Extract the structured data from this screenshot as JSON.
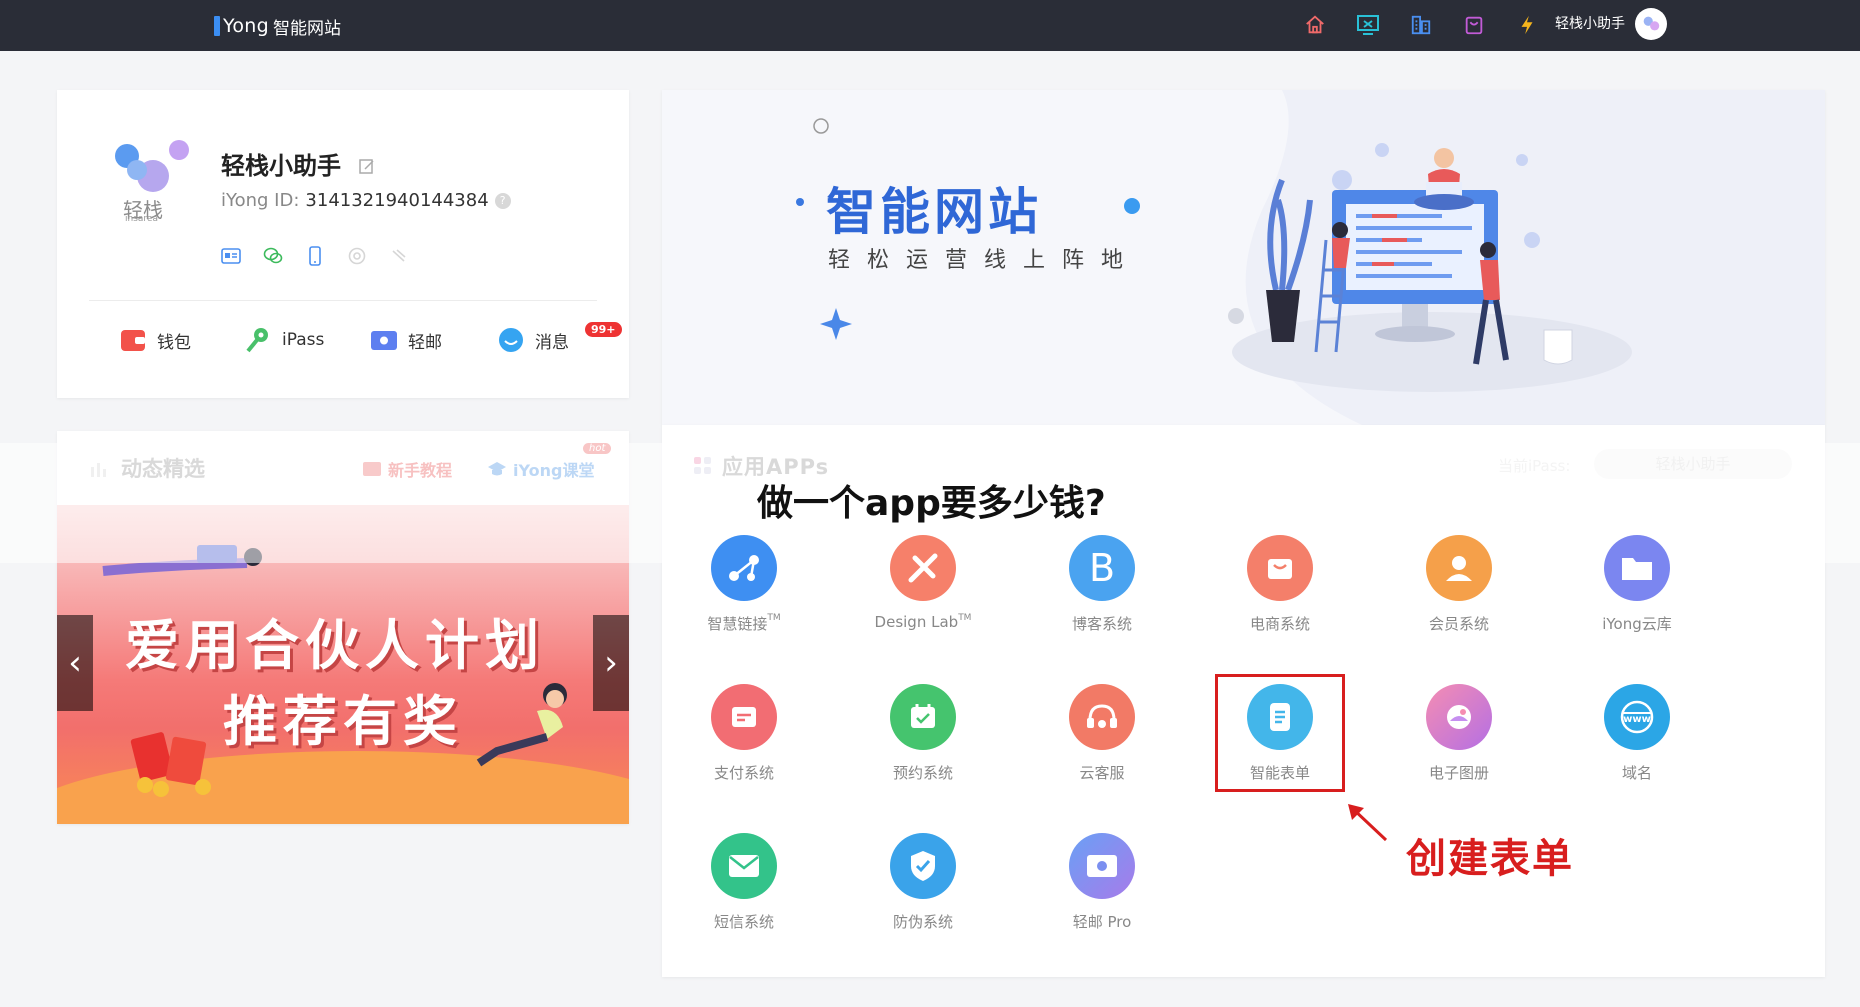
{
  "topbar": {
    "brand_letter": "i",
    "brand_name": "Yong",
    "brand_sub": "智能网站",
    "username": "轻栈小助手",
    "icons": [
      "home-icon",
      "monitor-icon",
      "building-icon",
      "bag-icon",
      "lightning-icon"
    ]
  },
  "profile": {
    "logo_text": "轻栈",
    "logo_sub": "insarea",
    "name": "轻栈小助手",
    "id_label": "iYong ID:",
    "id_value": "3141321940144384",
    "id_help": "?",
    "quick_links": [
      {
        "label": "钱包",
        "icon": "wallet-icon"
      },
      {
        "label": "iPass",
        "icon": "key-icon"
      },
      {
        "label": "轻邮",
        "icon": "mail-icon"
      },
      {
        "label": "消息",
        "icon": "message-icon"
      }
    ],
    "message_badge": "99+"
  },
  "news": {
    "title": "动态精选",
    "tab_tutorial": "新手教程",
    "tab_classroom": "iYong课堂",
    "hot": "hot",
    "banner_line1": "爱用合伙人计划",
    "banner_line2": "推荐有奖",
    "prev": "‹",
    "next": "›"
  },
  "hero": {
    "title": "智能网站",
    "subtitle": "轻松运营线上阵地"
  },
  "apps": {
    "title": "应用APPs",
    "ipass_label": "当前iPass:",
    "ipass_value": "轻栈小助手",
    "overlay_question": "做一个app要多少钱?",
    "callout": "创建表单",
    "items": [
      {
        "label": "智慧链接",
        "tm": "TM",
        "color": "#3e8ff2",
        "icon": "link-nodes-icon"
      },
      {
        "label": "Design Lab",
        "tm": "TM",
        "color": "#f6806a",
        "icon": "design-tools-icon"
      },
      {
        "label": "博客系统",
        "tm": "",
        "color": "#4aa3f0",
        "icon": "letter-b-icon"
      },
      {
        "label": "电商系统",
        "tm": "",
        "color": "#f47f6a",
        "icon": "shop-icon"
      },
      {
        "label": "会员系统",
        "tm": "",
        "color": "#f5a04a",
        "icon": "user-icon"
      },
      {
        "label": "iYong云库",
        "tm": "",
        "color": "#7b86f0",
        "icon": "folder-icon"
      },
      {
        "label": "支付系统",
        "tm": "",
        "color": "#f26d73",
        "icon": "payment-card-icon"
      },
      {
        "label": "预约系统",
        "tm": "",
        "color": "#45c46e",
        "icon": "calendar-icon"
      },
      {
        "label": "云客服",
        "tm": "",
        "color": "#f27a66",
        "icon": "headset-icon"
      },
      {
        "label": "智能表单",
        "tm": "",
        "color": "#43b6ea",
        "icon": "form-doc-icon"
      },
      {
        "label": "电子图册",
        "tm": "",
        "color": "#c46fe0",
        "icon": "album-icon"
      },
      {
        "label": "域名",
        "tm": "",
        "color": "#2ba6e6",
        "icon": "www-globe-icon"
      },
      {
        "label": "短信系统",
        "tm": "",
        "color": "#33c38a",
        "icon": "sms-envelope-icon"
      },
      {
        "label": "防伪系统",
        "tm": "",
        "color": "#3aa3ea",
        "icon": "shield-check-icon"
      },
      {
        "label": "轻邮 Pro",
        "tm": "",
        "color": "#5c88ee",
        "icon": "mail-pro-icon"
      }
    ]
  }
}
